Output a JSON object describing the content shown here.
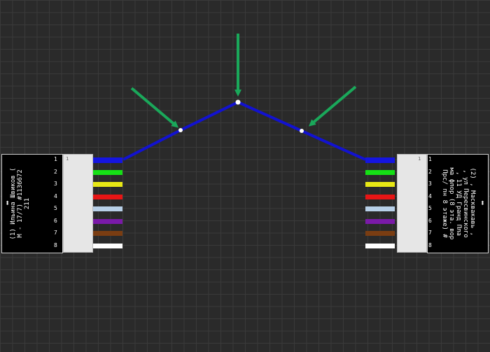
{
  "left_cable": {
    "label": "(1) Ильина Швиков (\nМ - 17/7) #1136672\n211",
    "pins": [
      "1",
      "2",
      "3",
      "4",
      "5",
      "6",
      "7",
      "8"
    ],
    "connector_pin": "1"
  },
  "right_cable": {
    "label": "(2) , Масквакавь , \n, ул Пересвинского\n, 11 УД Гранд Пла\nма флор (8 эта. вор\nПрс/ пн 8 этаже) #",
    "pins": [
      "1",
      "2",
      "3",
      "4",
      "5",
      "6",
      "7",
      "8"
    ],
    "connector_pin": "1"
  },
  "wire_colors": [
    "#1515e0",
    "#15e015",
    "#e8e815",
    "#e81515",
    "#b8d0e8",
    "#7a1aa8",
    "#7a3d12",
    "#ffffff"
  ],
  "link_color": "#1212d0",
  "arrow_color": "#1aa85a",
  "icons": {
    "direction_arrow": "⬍"
  }
}
